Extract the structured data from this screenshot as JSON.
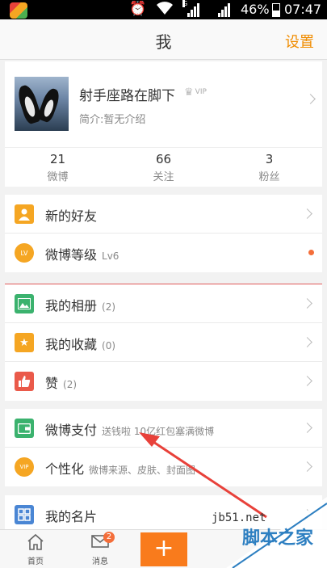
{
  "statusbar": {
    "network_type": "G",
    "battery": "46%",
    "time": "07:47"
  },
  "header": {
    "title": "我",
    "settings_label": "设置"
  },
  "profile": {
    "nickname": "射手座路在脚下",
    "vip_label": "VIP",
    "bio": "简介:暂无介绍",
    "stats": [
      {
        "count": "21",
        "label": "微博"
      },
      {
        "count": "66",
        "label": "关注"
      },
      {
        "count": "3",
        "label": "粉丝"
      }
    ]
  },
  "menu_group_1": [
    {
      "label": "新的好友",
      "icon": "person-icon",
      "sub": ""
    },
    {
      "label": "微博等级",
      "icon": "level-icon",
      "sub": "Lv6",
      "dot": true
    }
  ],
  "menu_group_2": [
    {
      "label": "我的相册",
      "icon": "album-icon",
      "sub": "(2)"
    },
    {
      "label": "我的收藏",
      "icon": "star-icon",
      "sub": "(0)"
    },
    {
      "label": "赞",
      "icon": "thumbs-up-icon",
      "sub": "(2)"
    }
  ],
  "menu_group_3": [
    {
      "label": "微博支付",
      "icon": "wallet-icon",
      "sub": "送钱啦 10亿红包塞满微博"
    },
    {
      "label": "个性化",
      "icon": "vip-personalize-icon",
      "sub": "微博来源、皮肤、封面图"
    }
  ],
  "menu_group_4": [
    {
      "label": "我的名片",
      "icon": "qr-card-icon",
      "sub": ""
    }
  ],
  "bottomnav": {
    "home_label": "首页",
    "messages_label": "消息",
    "messages_badge": "2",
    "compose_label": "+"
  },
  "watermark": {
    "url": "jb51.net",
    "text": "脚本之家"
  },
  "colors": {
    "accent": "#f08c00",
    "compose": "#f97b1c",
    "annotation_arrow": "#e8413a"
  }
}
